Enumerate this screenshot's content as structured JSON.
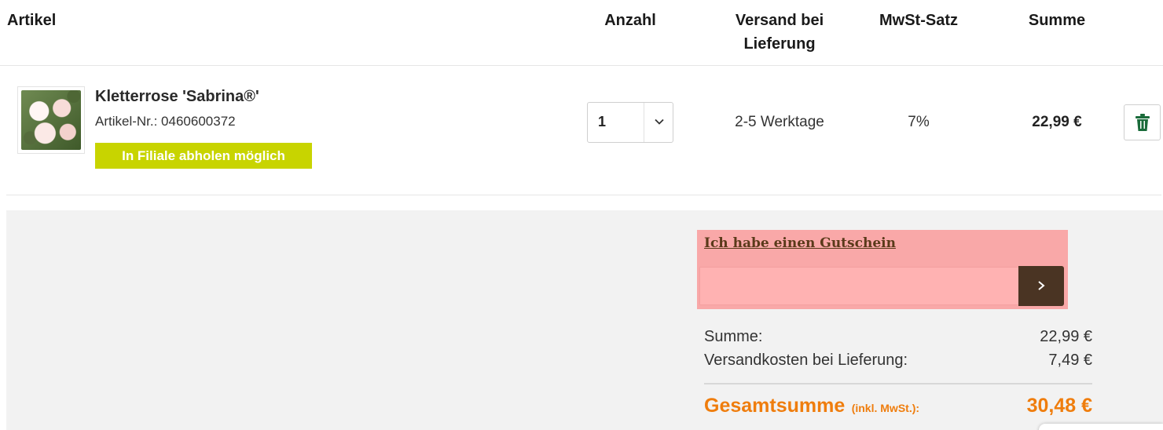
{
  "table_header": {
    "artikel": "Artikel",
    "anzahl": "Anzahl",
    "versand_line1": "Versand bei",
    "versand_line2": "Lieferung",
    "mwst": "MwSt-Satz",
    "summe": "Summe"
  },
  "cart_item": {
    "image_icon": "rose-product-image",
    "name": "Kletterrose 'Sabrina®'",
    "article_nr": "Artikel-Nr.: 0460600372",
    "pickup_badge": "In Filiale abholen möglich",
    "quantity": "1",
    "delivery": "2-5 Werktage",
    "vat_rate": "7%",
    "sum": "22,99 €"
  },
  "voucher": {
    "link": "Ich habe einen Gutschein",
    "input_value": "",
    "input_placeholder": ""
  },
  "summary": {
    "subtotal_label": "Summe:",
    "subtotal_value": "22,99 €",
    "shipping_label": "Versandkosten bei Lieferung:",
    "shipping_value": "7,49 €",
    "total_label": "Gesamtsumme",
    "total_note": "(inkl. MwSt.):",
    "total_value": "30,48 €"
  },
  "colors": {
    "badge_green": "#c8d400",
    "trash_green": "#1a6b3a",
    "voucher_bg": "#f9a8a8",
    "voucher_button": "#4a3423",
    "total_orange": "#ef7d0d"
  }
}
